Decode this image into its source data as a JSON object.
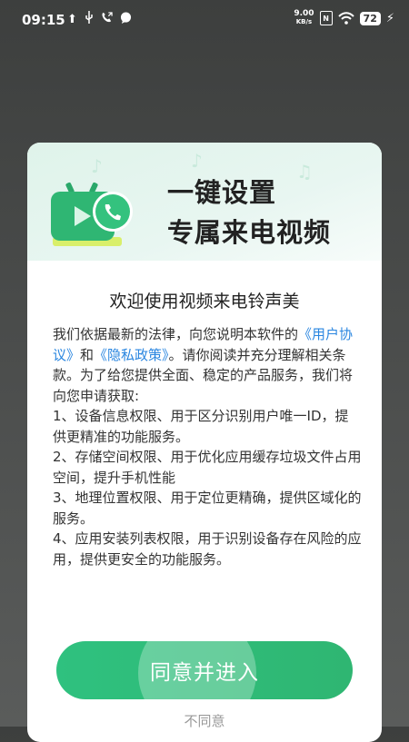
{
  "status_bar": {
    "time": "09:15",
    "icons_left": [
      "upload-icon",
      "usb-icon",
      "phone-call-icon",
      "message-icon"
    ],
    "network_speed": "9.00",
    "network_unit": "KB/s",
    "battery": "72"
  },
  "dialog": {
    "hero": {
      "line1": "一键设置",
      "line2": "专属来电视频"
    },
    "title": "欢迎使用视频来电铃声美",
    "body": {
      "intro_before": "我们依据最新的法律，向您说明本软件的",
      "link_user_agreement": "《用户协议》",
      "and": "和",
      "link_privacy_policy": "《隐私政策》",
      "intro_after": "。请你阅读并充分理解相关条款。为了给您提供全面、稳定的产品服务，我们将向您申请获取:",
      "items": [
        "1、设备信息权限、用于区分识别用户唯一ID，提供更精准的功能服务。",
        "2、存储空间权限、用于优化应用缓存垃圾文件占用空间，提升手机性能",
        "3、地理位置权限、用于定位更精确，提供区域化的服务。",
        "4、应用安装列表权限，用于识别设备存在风险的应用，提供更安全的功能服务。"
      ]
    },
    "agree_label": "同意并进入",
    "disagree_label": "不同意"
  },
  "colors": {
    "accent": "#2fbf7c",
    "link": "#2a86e0",
    "hero_bg": "#dff3ea"
  }
}
